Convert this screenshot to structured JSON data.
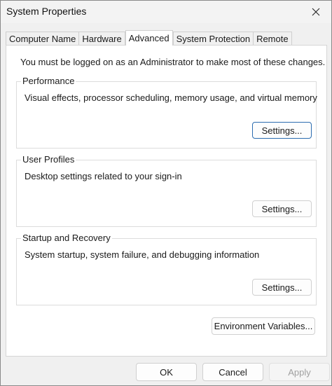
{
  "window": {
    "title": "System Properties"
  },
  "tabs": [
    {
      "label": "Computer Name",
      "active": false
    },
    {
      "label": "Hardware",
      "active": false
    },
    {
      "label": "Advanced",
      "active": true
    },
    {
      "label": "System Protection",
      "active": false
    },
    {
      "label": "Remote",
      "active": false
    }
  ],
  "advanced": {
    "admin_note": "You must be logged on as an Administrator to make most of these changes.",
    "performance": {
      "label": "Performance",
      "description": "Visual effects, processor scheduling, memory usage, and virtual memory",
      "button": "Settings..."
    },
    "user_profiles": {
      "label": "User Profiles",
      "description": "Desktop settings related to your sign-in",
      "button": "Settings..."
    },
    "startup_recovery": {
      "label": "Startup and Recovery",
      "description": "System startup, system failure, and debugging information",
      "button": "Settings..."
    },
    "env_button": "Environment Variables..."
  },
  "footer": {
    "ok": "OK",
    "cancel": "Cancel",
    "apply": "Apply"
  },
  "colors": {
    "focus_border": "#2b6cb0",
    "disabled_text": "#a0a0a0"
  }
}
